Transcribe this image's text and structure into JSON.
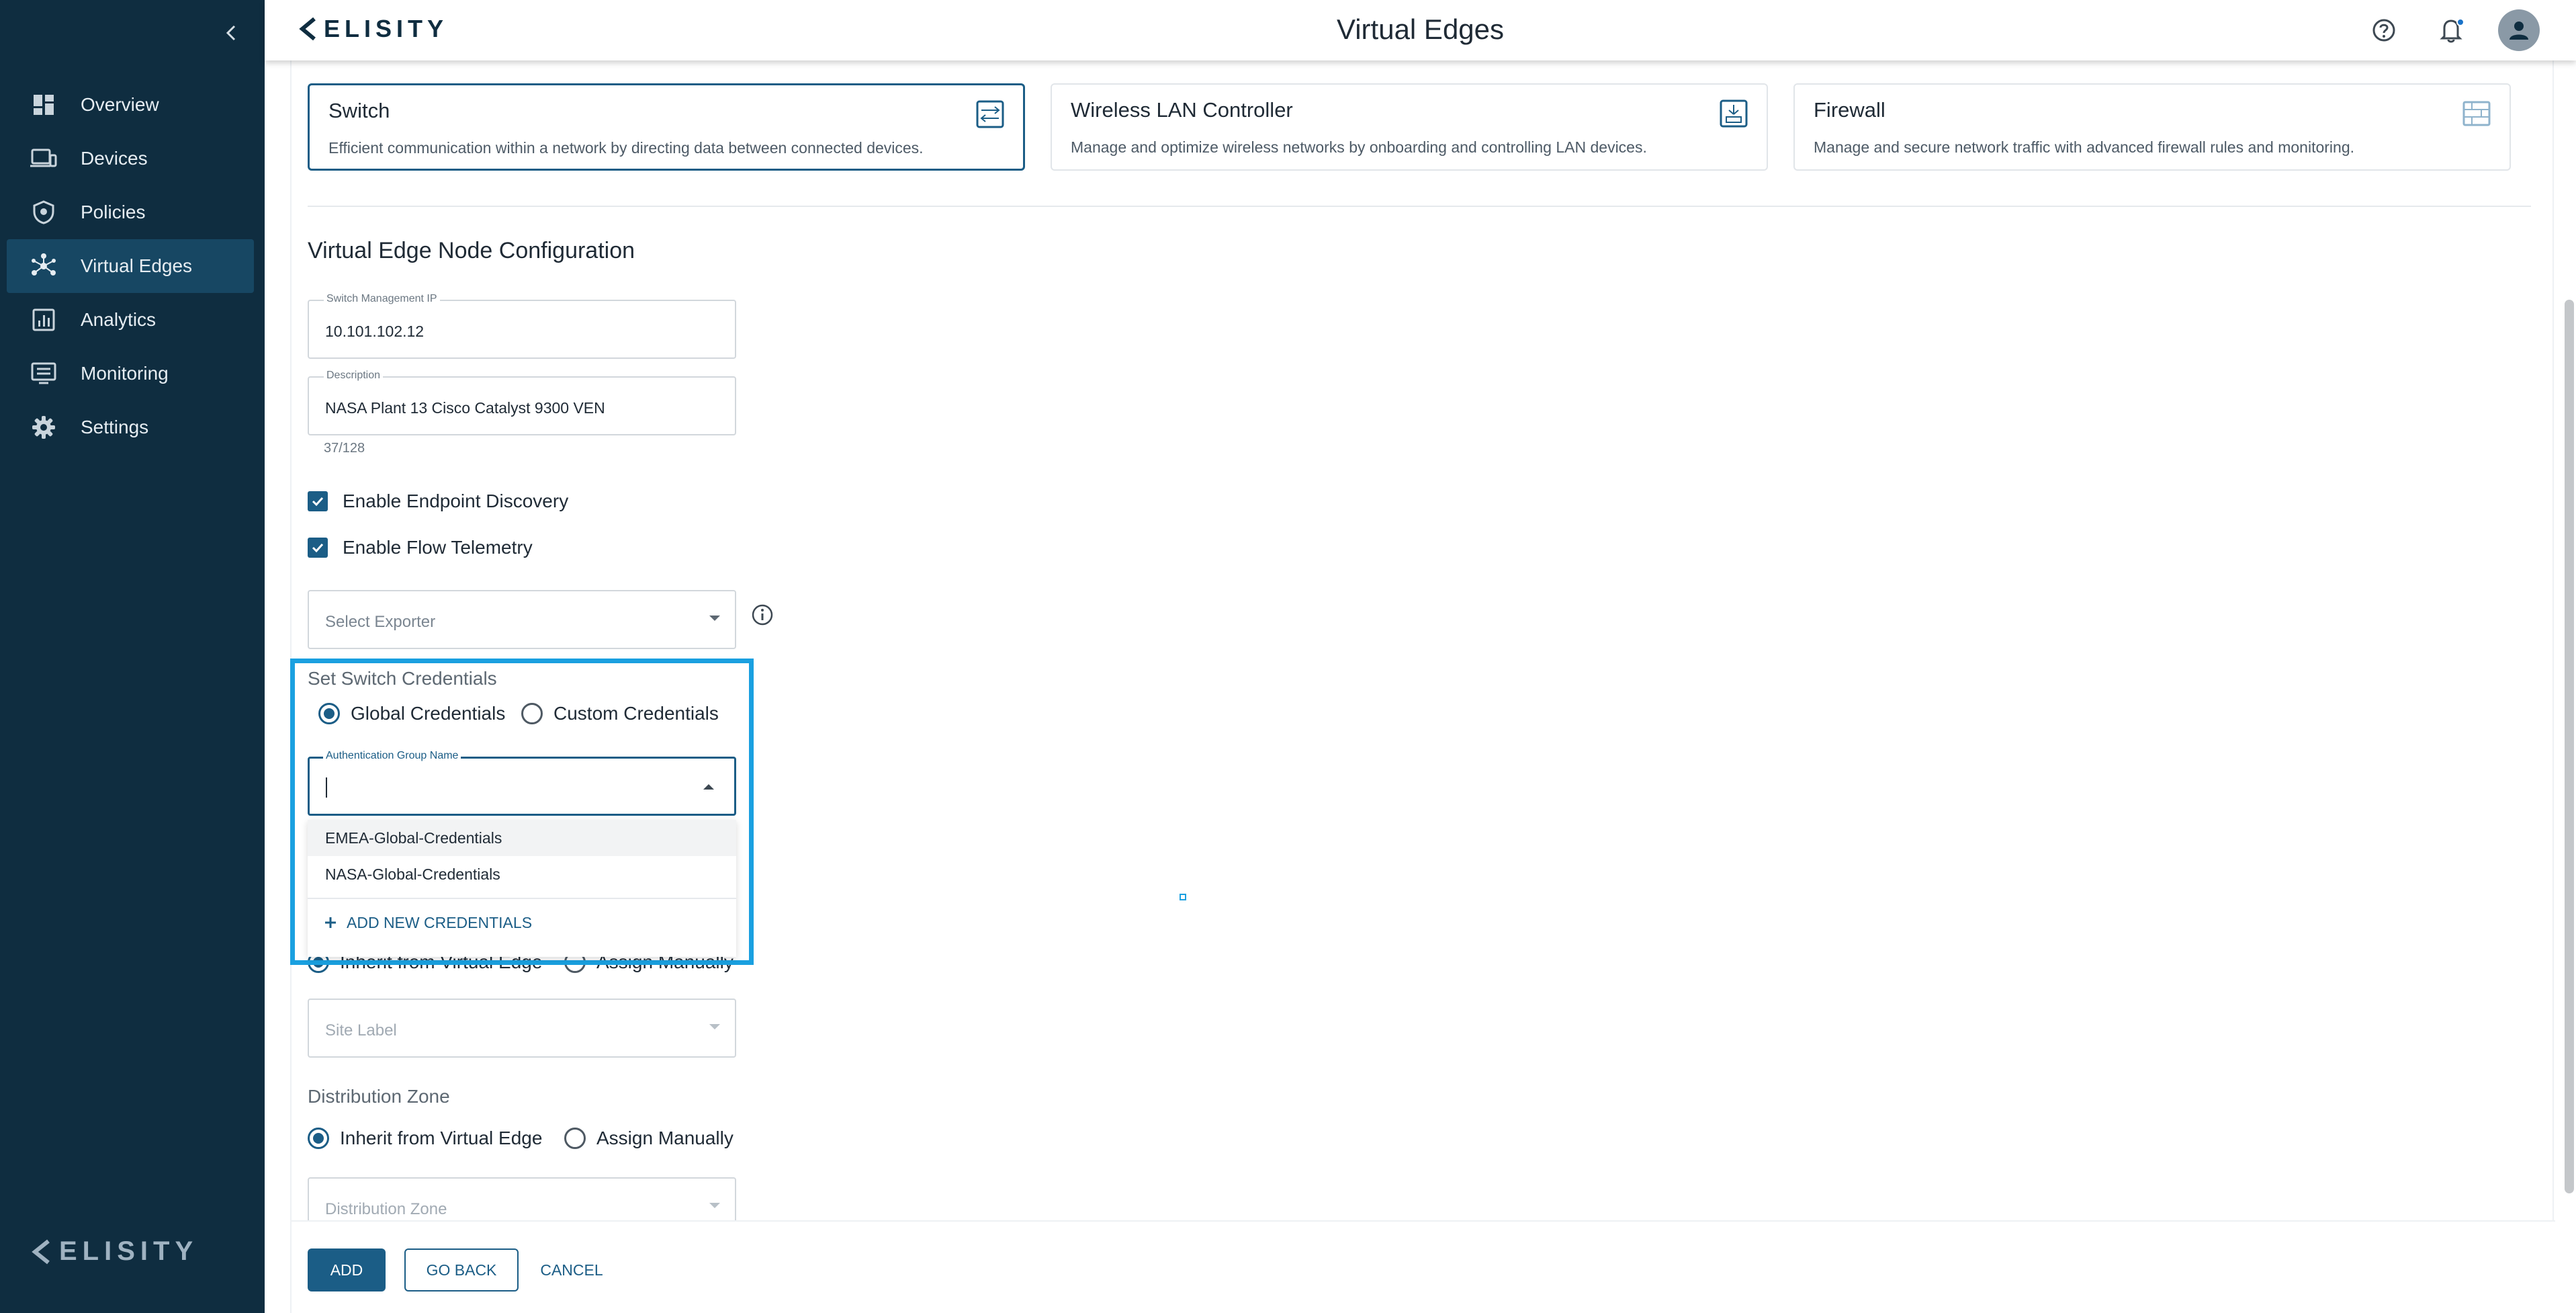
{
  "app": {
    "brand": "ELISITY",
    "page_title": "Virtual Edges"
  },
  "sidebar": {
    "items": [
      {
        "label": "Overview",
        "icon": "dashboard-icon"
      },
      {
        "label": "Devices",
        "icon": "devices-icon"
      },
      {
        "label": "Policies",
        "icon": "shield-icon"
      },
      {
        "label": "Virtual Edges",
        "icon": "network-icon",
        "active": true
      },
      {
        "label": "Analytics",
        "icon": "analytics-icon"
      },
      {
        "label": "Monitoring",
        "icon": "monitor-icon"
      },
      {
        "label": "Settings",
        "icon": "gear-icon"
      }
    ]
  },
  "header": {
    "icons": [
      "help-icon",
      "bell-icon",
      "user-avatar-icon"
    ]
  },
  "type_cards": [
    {
      "title": "Switch",
      "description": "Efficient communication within a network by directing data between connected devices.",
      "selected": true
    },
    {
      "title": "Wireless LAN Controller",
      "description": "Manage and optimize wireless networks by onboarding and controlling LAN devices.",
      "selected": false
    },
    {
      "title": "Firewall",
      "description": "Manage and secure network traffic with advanced firewall rules and monitoring.",
      "selected": false
    }
  ],
  "config": {
    "section_title": "Virtual Edge Node Configuration",
    "mgmt_ip": {
      "label": "Switch Management IP",
      "value": "10.101.102.12"
    },
    "description": {
      "label": "Description",
      "value": "NASA Plant 13 Cisco Catalyst 9300 VEN",
      "count": "37/128"
    },
    "endpoint_discovery": {
      "label": "Enable Endpoint Discovery",
      "checked": true
    },
    "flow_telemetry": {
      "label": "Enable Flow Telemetry",
      "checked": true
    },
    "exporter": {
      "placeholder": "Select Exporter"
    },
    "credentials": {
      "title": "Set Switch Credentials",
      "option_global": "Global Credentials",
      "option_custom": "Custom Credentials",
      "selected": "global",
      "auth_group": {
        "label": "Authentication Group Name",
        "value": ""
      },
      "dropdown_options": [
        "EMEA-Global-Credentials",
        "NASA-Global-Credentials"
      ],
      "add_new_label": "ADD NEW CREDENTIALS"
    },
    "site_label": {
      "option_inherit": "Inherit from Virtual Edge",
      "option_manual": "Assign Manually",
      "placeholder": "Site Label"
    },
    "distribution_zone": {
      "title": "Distribution Zone",
      "option_inherit": "Inherit from Virtual Edge",
      "option_manual": "Assign Manually",
      "placeholder": "Distribution Zone"
    }
  },
  "footer": {
    "add": "ADD",
    "go_back": "GO BACK",
    "cancel": "CANCEL"
  },
  "colors": {
    "sidebar_bg": "#0f2d40",
    "primary": "#1b5d86",
    "highlight": "#1aa0e0"
  }
}
